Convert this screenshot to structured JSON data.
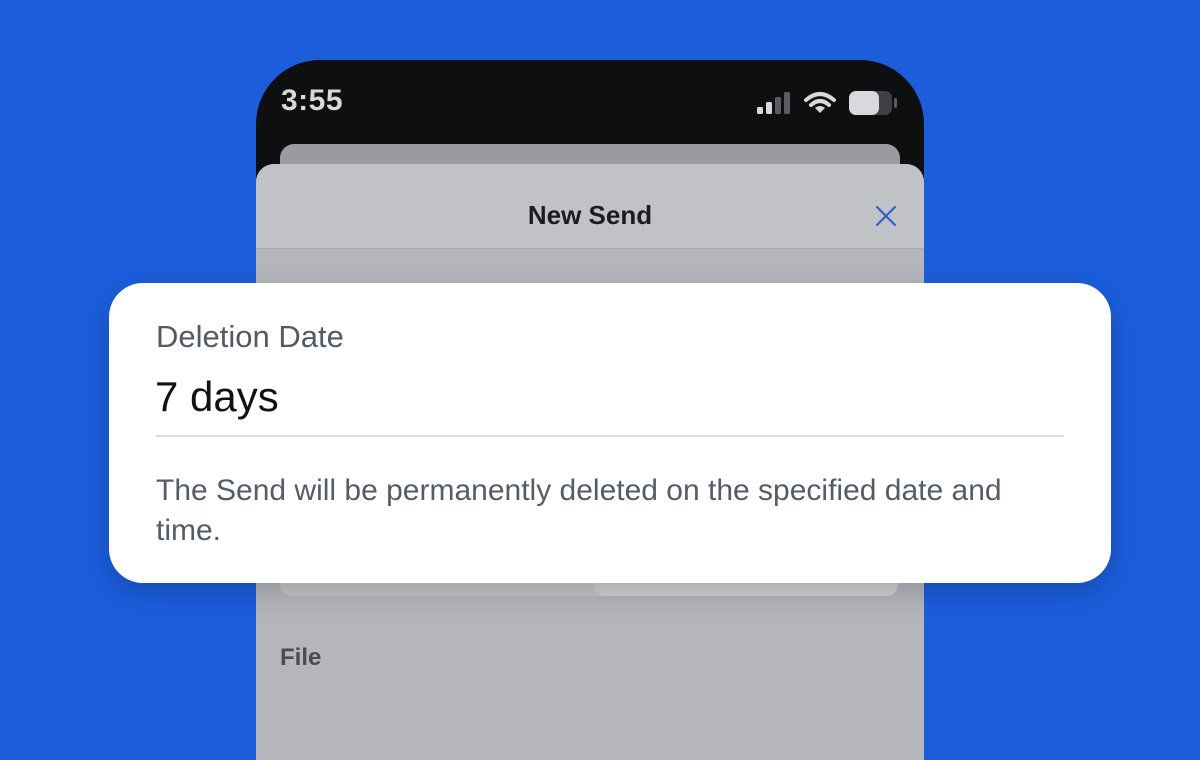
{
  "colors": {
    "background": "#1b5ddb",
    "phone": "#0e0f11",
    "sheet": "#b4b6bb",
    "accent": "#2b5fd0",
    "card": "#ffffff"
  },
  "status_bar": {
    "time": "3:55",
    "icons": [
      "cellular-signal-icon",
      "wifi-icon",
      "battery-icon"
    ]
  },
  "sheet": {
    "title": "New Send",
    "close_icon": "close-icon",
    "file_label": "File"
  },
  "callout": {
    "label": "Deletion Date",
    "value": "7 days",
    "help": "The Send will be permanently deleted on the specified date and time."
  }
}
